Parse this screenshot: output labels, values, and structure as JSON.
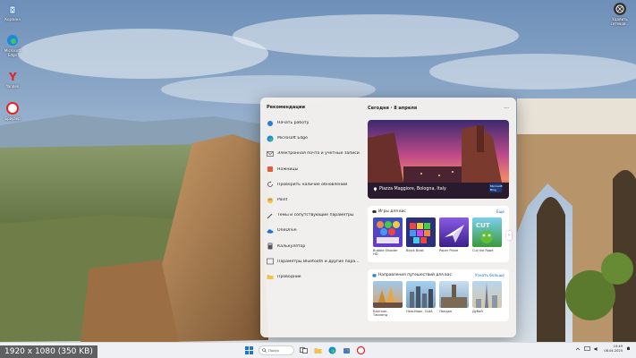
{
  "desktop_icons": [
    {
      "label": "Корзина",
      "icon": "recycle-bin-icon"
    },
    {
      "label": "Microsoft Edge",
      "icon": "edge-icon"
    },
    {
      "label": "Yandex",
      "icon": "yandex-browser-icon"
    },
    {
      "label": "Браузер",
      "icon": "yandex-icon"
    }
  ],
  "top_right_icon": {
    "label": "Удалить сетевой...",
    "icon": "settings-icon"
  },
  "widgets": {
    "recommendations_title": "Рекомендации",
    "recommendations": [
      {
        "label": "Начать работу",
        "icon": "rocket-icon"
      },
      {
        "label": "Microsoft Edge",
        "icon": "edge-icon"
      },
      {
        "label": "Электронная почта и учетные записи",
        "icon": "mail-icon"
      },
      {
        "label": "Ножницы",
        "icon": "scissors-icon"
      },
      {
        "label": "Проверить наличие обновлений",
        "icon": "refresh-icon"
      },
      {
        "label": "Paint",
        "icon": "paint-icon"
      },
      {
        "label": "Темы и сопутствующие параметры",
        "icon": "brush-icon"
      },
      {
        "label": "OneDrive",
        "icon": "cloud-icon"
      },
      {
        "label": "Калькулятор",
        "icon": "calculator-icon"
      },
      {
        "label": "Параметры Bluetooth и другие пара...",
        "icon": "bluetooth-icon"
      },
      {
        "label": "Проводник",
        "icon": "folder-icon"
      }
    ],
    "date_header": "Сегодня · 8 апреля",
    "more": "···",
    "hero_caption": "Piazza Maggiore, Bologna, Italy",
    "hero_badge": "Microsoft Bing",
    "games": {
      "title": "Игры для вас",
      "link": "Еще",
      "tiles": [
        {
          "caption": "Bubble Shooter HD"
        },
        {
          "caption": "Block Blast"
        },
        {
          "caption": "Paper Plane"
        },
        {
          "caption": "Cut the Rope"
        }
      ]
    },
    "travel": {
      "title": "Направления путешествий для вас",
      "link": "Узнать больше",
      "tiles": [
        {
          "caption": "Бангкок, Таиланд"
        },
        {
          "caption": "Нью-Йорк, США"
        },
        {
          "caption": "Лондон"
        },
        {
          "caption": "Дубай"
        }
      ]
    }
  },
  "taskbar": {
    "search_placeholder": "Поиск",
    "time": "10:49",
    "date": "08.04.2025"
  },
  "resolution_label": "1920 x 1080 (350 KB)",
  "colors": {
    "accent": "#1a6ed8",
    "panel": "#f3f0ee",
    "taskbar": "#eef0f3"
  }
}
